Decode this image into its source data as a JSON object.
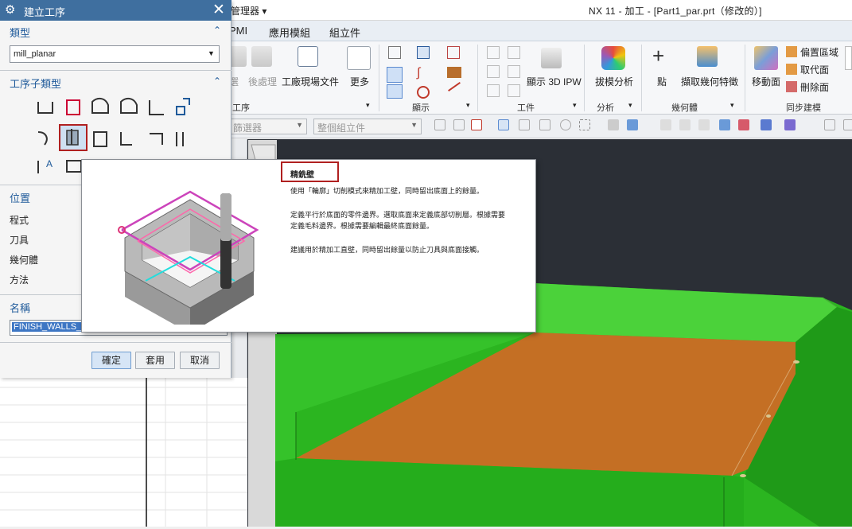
{
  "titlebar": {
    "nav_label": "管理器 ▾",
    "window_title": "NX 11 - 加工 - [Part1_par.prt（修改的）]"
  },
  "menubar": {
    "tabs": [
      "PMI",
      "應用模組",
      "組立件"
    ]
  },
  "ribbon": {
    "left_partial": [
      "選",
      "後處理"
    ],
    "shop_doc": "工廠現場文件",
    "more": "更多",
    "display_ipw": "顯示 3D IPW",
    "draft_analysis": "拔模分析",
    "point": "點",
    "extract_geometry": "擷取幾何特徵",
    "move_face": "移動面",
    "offset_region": "偏置區域",
    "replace_face": "取代面",
    "delete_face": "刪除面",
    "groups": {
      "operation": "工序",
      "display": "顯示",
      "workpiece": "工件",
      "analysis": "分析",
      "geometry": "幾何體",
      "sync_modeling": "同步建模"
    }
  },
  "filterbar": {
    "filter_placeholder": "篩選器",
    "scope_placeholder": "整個組立件"
  },
  "dialog": {
    "title": "建立工序",
    "type_header": "類型",
    "type_value": "mill_planar",
    "subtype_header": "工序子類型",
    "position_header": "位置",
    "program_label": "程式",
    "tool_label": "刀具",
    "geometry_label": "幾何體",
    "method_label": "方法",
    "name_header": "名稱",
    "name_value": "FINISH_WALLS_1",
    "ok": "確定",
    "apply": "套用",
    "cancel": "取消"
  },
  "tooltip": {
    "title": "精銑壁",
    "lines": [
      "使用「輪廓」切削模式來精加工壁，同時留出底面上的餘量。",
      "定義平行於底面的零件邊界。選取底面來定義底部切削層。根據需要",
      "定義毛料邊界。根據需要編輯最終底面餘量。",
      "建議用於精加工直壁，同時留出餘量以防止刀具與底面接觸。"
    ]
  },
  "colors": {
    "dialog_title_bg": "#3f6f9f",
    "viewport_bg": "#2b2f36",
    "part_green": "#22a81c",
    "floor_brown": "#c46f24",
    "highlight_red": "#b02020"
  },
  "icons": [
    "settings-gear-icon",
    "close-icon",
    "chevron-up-icon",
    "dropdown-arrow-icon"
  ]
}
